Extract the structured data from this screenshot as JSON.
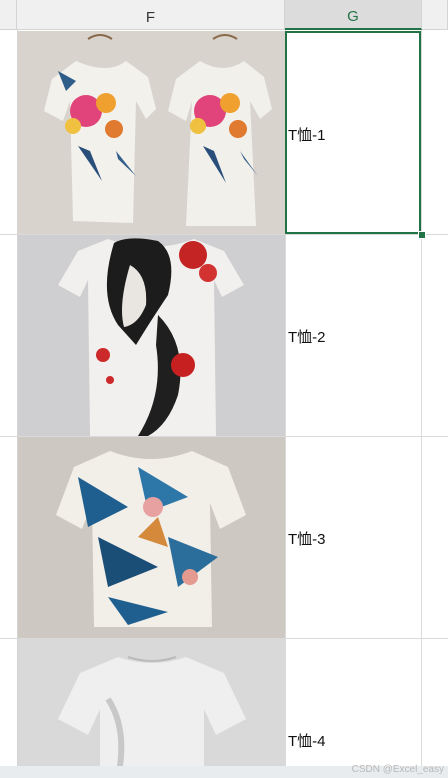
{
  "columns": {
    "f": "F",
    "g": "G"
  },
  "rows": [
    {
      "label": "T恤-1"
    },
    {
      "label": "T恤-2"
    },
    {
      "label": "T恤-3"
    },
    {
      "label": "T恤-4"
    }
  ],
  "watermark": "CSDN @Excel_easy",
  "colors": {
    "accent": "#217346",
    "grid": "#dadada"
  }
}
